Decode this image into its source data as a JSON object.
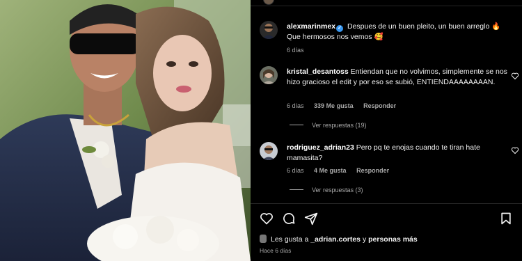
{
  "post": {
    "photo_alt": "couple wedding photo"
  },
  "comments": [
    {
      "username": "alexmarinmex",
      "verified": true,
      "text": "Despues de un buen pleito, un buen arreglo 🔥 Que hermosos nos vemos 🥰",
      "time": "6 días"
    },
    {
      "username": "kristal_desantoss",
      "text": "Entiendan que no volvimos, simplemente se nos hizo gracioso el edit y por eso se subió, ENTIENDAAAAAAAAN.",
      "time": "6 días",
      "likes": "339 Me gusta",
      "reply": "Responder",
      "view_replies": "Ver respuestas (19)"
    },
    {
      "username": "rodriguez_adrian23",
      "text": "Pero pq te enojas cuando te tiran hate mamasita?",
      "time": "6 días",
      "likes": "4 Me gusta",
      "reply": "Responder",
      "view_replies": "Ver respuestas (3)"
    }
  ],
  "footer": {
    "likes_prefix": "Les gusta a",
    "likes_user": "_adrian.cortes",
    "likes_and": "y",
    "likes_more": "personas más",
    "time": "Hace 6 días"
  },
  "icons": {
    "like": "heart-icon",
    "comment": "comment-icon",
    "share": "share-icon",
    "save": "bookmark-icon"
  },
  "colors": {
    "background": "#000000",
    "text": "#f5f5f5",
    "muted": "#a8a8a8",
    "verified": "#3897f0"
  }
}
